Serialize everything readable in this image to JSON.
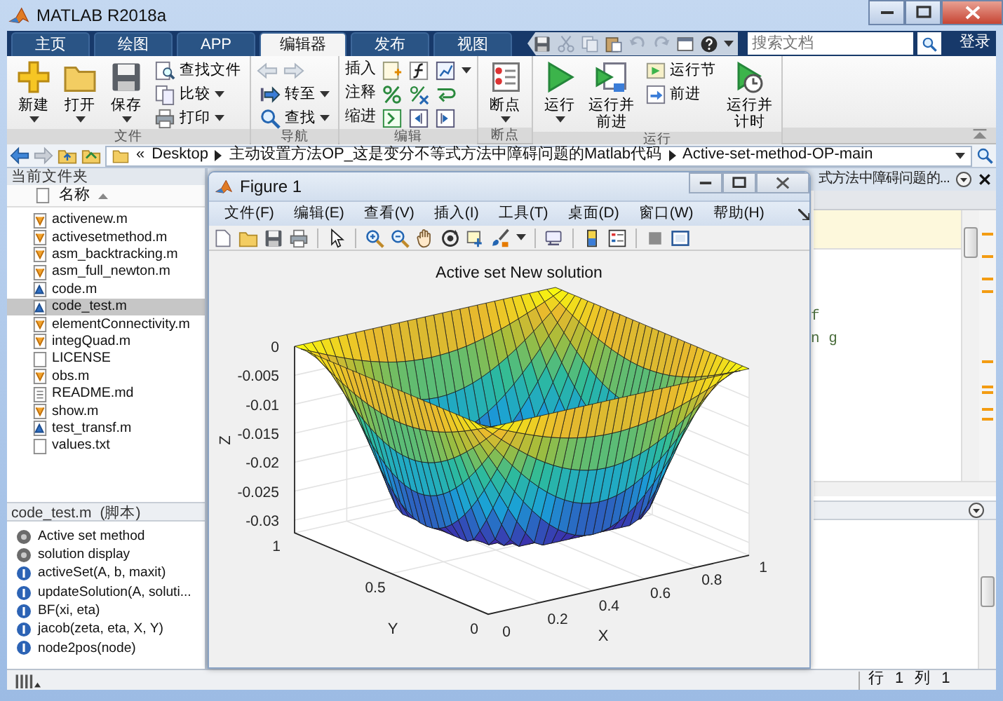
{
  "window": {
    "title": "MATLAB R2018a"
  },
  "tabs": [
    {
      "label": "主页",
      "selected": false
    },
    {
      "label": "绘图",
      "selected": false
    },
    {
      "label": "APP",
      "selected": false
    },
    {
      "label": "编辑器",
      "selected": true
    },
    {
      "label": "发布",
      "selected": false
    },
    {
      "label": "视图",
      "selected": false
    }
  ],
  "search": {
    "placeholder": "搜索文档"
  },
  "sign_in": "登录",
  "ribbon_groups": [
    {
      "label": "文件",
      "items": [
        {
          "kind": "large",
          "label": "新建",
          "dropdown": true
        },
        {
          "kind": "large",
          "label": "打开",
          "dropdown": true
        },
        {
          "kind": "large",
          "label": "保存",
          "dropdown": true
        },
        {
          "kind": "small",
          "label": "查找文件",
          "dropdown": false
        },
        {
          "kind": "small",
          "label": "比较",
          "dropdown": true
        },
        {
          "kind": "small",
          "label": "打印",
          "dropdown": true
        }
      ]
    },
    {
      "label": "导航",
      "items": [
        {
          "kind": "arrows"
        },
        {
          "kind": "small",
          "label": "转至",
          "dropdown": true
        },
        {
          "kind": "small",
          "label": "查找",
          "dropdown": true
        }
      ]
    },
    {
      "label": "编辑",
      "items": [
        {
          "kind": "tool-row",
          "label": "插入",
          "dropdown": true
        },
        {
          "kind": "tool-row",
          "label": "注释",
          "dropdown": false
        },
        {
          "kind": "tool-row",
          "label": "缩进",
          "dropdown": false
        }
      ]
    },
    {
      "label": "断点",
      "items": [
        {
          "kind": "large",
          "label": "断点",
          "dropdown": true
        }
      ]
    },
    {
      "label": "运行",
      "items": [
        {
          "kind": "large",
          "label": "运行",
          "dropdown": true
        },
        {
          "kind": "large",
          "label": "运行并前进",
          "dropdown": false
        },
        {
          "kind": "small",
          "label": "运行节",
          "dropdown": false
        },
        {
          "kind": "small",
          "label": "前进",
          "dropdown": false
        },
        {
          "kind": "large",
          "label": "运行并计时",
          "dropdown": false
        }
      ]
    }
  ],
  "address": {
    "overflow": "«",
    "path": [
      "Desktop",
      "主动设置方法OP_这是变分不等式方法中障碍问题的Matlab代码",
      "Active-set-method-OP-main"
    ]
  },
  "current_folder": {
    "title": "当前文件夹",
    "column": "名称",
    "files": [
      {
        "name": "activenew.m",
        "kind": "function",
        "selected": false
      },
      {
        "name": "activesetmethod.m",
        "kind": "function",
        "selected": false
      },
      {
        "name": "asm_backtracking.m",
        "kind": "function",
        "selected": false
      },
      {
        "name": "asm_full_newton.m",
        "kind": "function",
        "selected": false
      },
      {
        "name": "code.m",
        "kind": "script",
        "selected": false
      },
      {
        "name": "code_test.m",
        "kind": "script",
        "selected": true
      },
      {
        "name": "elementConnectivity.m",
        "kind": "function",
        "selected": false
      },
      {
        "name": "integQuad.m",
        "kind": "function",
        "selected": false
      },
      {
        "name": "LICENSE",
        "kind": "text",
        "selected": false
      },
      {
        "name": "obs.m",
        "kind": "function",
        "selected": false
      },
      {
        "name": "README.md",
        "kind": "markdown",
        "selected": false
      },
      {
        "name": "show.m",
        "kind": "function",
        "selected": false
      },
      {
        "name": "test_transf.m",
        "kind": "script",
        "selected": false
      },
      {
        "name": "values.txt",
        "kind": "text",
        "selected": false
      }
    ]
  },
  "details": {
    "file": "code_test.m",
    "type": "(脚本)",
    "outline": [
      {
        "kind": "section",
        "label": "Active set method"
      },
      {
        "kind": "section",
        "label": "solution display"
      },
      {
        "kind": "function",
        "label": "activeSet(A, b, maxit)"
      },
      {
        "kind": "function",
        "label": "updateSolution(A, soluti..."
      },
      {
        "kind": "function",
        "label": "BF(xi, eta)"
      },
      {
        "kind": "function",
        "label": "jacob(zeta, eta, X, Y)"
      },
      {
        "kind": "function",
        "label": "node2pos(node)"
      }
    ]
  },
  "editor": {
    "tab_title": "式方法中障碍问题的...",
    "code_fragments": [
      "f",
      "n g"
    ]
  },
  "figure": {
    "title": "Figure 1",
    "menus": [
      "文件(F)",
      "编辑(E)",
      "查看(V)",
      "插入(I)",
      "工具(T)",
      "桌面(D)",
      "窗口(W)",
      "帮助(H)"
    ],
    "plot": {
      "title": "Active set New solution",
      "z_label": "Z",
      "y_label": "Y",
      "x_label": "X",
      "z_ticks": [
        "0",
        "-0.005",
        "-0.01",
        "-0.015",
        "-0.02",
        "-0.025",
        "-0.03"
      ],
      "y_ticks": [
        "1",
        "0.5",
        "0"
      ],
      "x_ticks": [
        "0",
        "0.2",
        "0.4",
        "0.6",
        "0.8",
        "1"
      ]
    }
  },
  "status_bar": {
    "line_label": "行",
    "line": "1",
    "column_label": "列",
    "column": "1"
  }
}
